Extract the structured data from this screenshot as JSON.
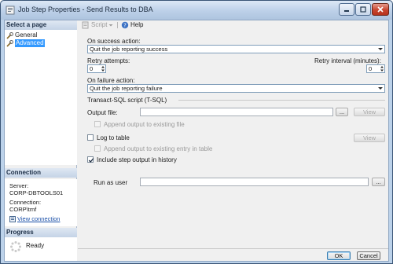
{
  "window": {
    "title": "Job Step Properties - Send Results to DBA"
  },
  "left": {
    "select_page_header": "Select a page",
    "pages": [
      {
        "label": "General",
        "selected": false
      },
      {
        "label": "Advanced",
        "selected": true
      }
    ],
    "connection_header": "Connection",
    "server_label": "Server:",
    "server_value": "CORP-DBTOOLS01",
    "connection_label": "Connection:",
    "connection_value": "CORP\\tmf",
    "view_connection": "View connection",
    "progress_header": "Progress",
    "progress_status": "Ready"
  },
  "toolbar": {
    "script_label": "Script",
    "help_label": "Help"
  },
  "form": {
    "on_success_label": "On success action:",
    "on_success_value": "Quit the job reporting success",
    "retry_attempts_label": "Retry attempts:",
    "retry_attempts_value": "0",
    "retry_interval_label": "Retry interval (minutes):",
    "retry_interval_value": "0",
    "on_failure_label": "On failure action:",
    "on_failure_value": "Quit the job reporting failure",
    "tsql_section": "Transact-SQL script (T-SQL)",
    "output_file_label": "Output file:",
    "browse_label": "...",
    "view_label": "View",
    "append_output_label": "Append output to existing file",
    "log_to_table_label": "Log to table",
    "append_table_label": "Append output to existing entry in table",
    "include_history_label": "Include step output in history",
    "include_history_checked": true,
    "run_as_user_label": "Run as user",
    "run_as_browse": "..."
  },
  "footer": {
    "ok_label": "OK",
    "cancel_label": "Cancel"
  }
}
